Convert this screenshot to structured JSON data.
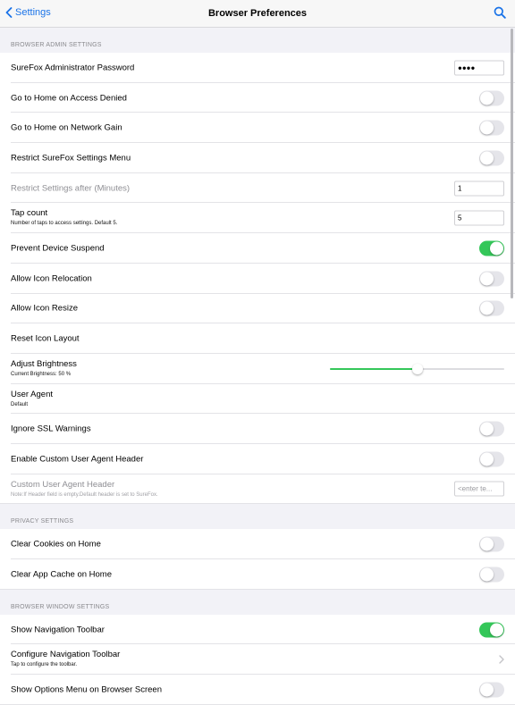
{
  "nav": {
    "back_label": "Settings",
    "title": "Browser Preferences"
  },
  "sections": [
    {
      "header": "BROWSER ADMIN SETTINGS",
      "rows": [
        {
          "label": "SureFox Administrator Password",
          "control": "text",
          "value": "●●●●"
        },
        {
          "label": "Go to Home on Access Denied",
          "control": "toggle",
          "on": false
        },
        {
          "label": "Go to Home on Network Gain",
          "control": "toggle",
          "on": false
        },
        {
          "label": "Restrict SureFox Settings Menu",
          "control": "toggle",
          "on": false
        },
        {
          "label": "Restrict Settings after (Minutes)",
          "control": "text",
          "value": "1",
          "disabled": true
        },
        {
          "label": "Tap count",
          "sub": "Number of taps to access settings. Default 5.",
          "control": "text",
          "value": "5"
        },
        {
          "label": "Prevent Device Suspend",
          "control": "toggle",
          "on": true
        },
        {
          "label": "Allow Icon Relocation",
          "control": "toggle",
          "on": false
        },
        {
          "label": "Allow Icon Resize",
          "control": "toggle",
          "on": false
        },
        {
          "label": "Reset Icon Layout",
          "control": "none"
        },
        {
          "label": "Adjust Brightness",
          "sub": "Current Brightness: 50 %",
          "control": "slider",
          "value": 0.5
        },
        {
          "label": "User Agent",
          "sub": "Default",
          "control": "none"
        },
        {
          "label": "Ignore SSL Warnings",
          "control": "toggle",
          "on": false
        },
        {
          "label": "Enable Custom User Agent Header",
          "control": "toggle",
          "on": false
        },
        {
          "label": "Custom User Agent Header",
          "sub": "Note:If Header field is empty.Default header is set to SureFox.",
          "control": "text",
          "placeholder": "<enter te...",
          "disabled": true
        }
      ]
    },
    {
      "header": "PRIVACY SETTINGS",
      "rows": [
        {
          "label": "Clear Cookies on Home",
          "control": "toggle",
          "on": false
        },
        {
          "label": "Clear App Cache on Home",
          "control": "toggle",
          "on": false
        }
      ]
    },
    {
      "header": "BROWSER WINDOW SETTINGS",
      "rows": [
        {
          "label": "Show Navigation Toolbar",
          "control": "toggle",
          "on": true
        },
        {
          "label": "Configure Navigation Toolbar",
          "sub": "Tap to configure the toolbar.",
          "control": "chevron"
        },
        {
          "label": "Show Options Menu on Browser Screen",
          "control": "toggle",
          "on": false
        }
      ]
    }
  ],
  "colors": {
    "accent": "#1a73e8",
    "toggle_on": "#34c759",
    "toggle_off": "#e5e5ea",
    "background": "#f2f2f7"
  },
  "icons": {
    "back": "chevron-left-icon",
    "search": "search-icon",
    "disclosure": "chevron-right-icon"
  }
}
